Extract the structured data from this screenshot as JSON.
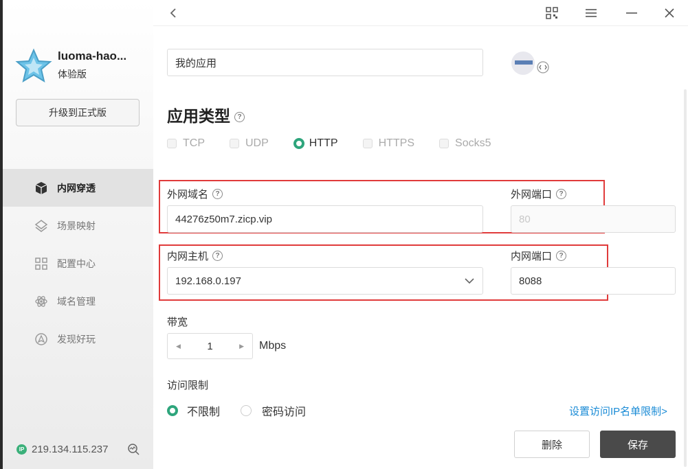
{
  "sidebar": {
    "app_name": "luoma-hao...",
    "edition": "体验版",
    "upgrade_label": "升级到正式版",
    "items": [
      {
        "label": "内网穿透",
        "icon": "cube-icon",
        "active": true
      },
      {
        "label": "场景映射",
        "icon": "layers-icon",
        "active": false
      },
      {
        "label": "配置中心",
        "icon": "grid-icon",
        "active": false
      },
      {
        "label": "域名管理",
        "icon": "atom-icon",
        "active": false
      },
      {
        "label": "发现好玩",
        "icon": "compass-icon",
        "active": false
      }
    ],
    "ip_badge": "IP",
    "ip_address": "219.134.115.237"
  },
  "topbar": {
    "back_icon": "chevron-left-icon",
    "qr_icon": "qrcode-icon",
    "menu_icon": "hamburger-icon",
    "minimize_icon": "minimize-icon",
    "close_icon": "close-icon"
  },
  "form": {
    "app_name_value": "我的应用",
    "app_type_title": "应用类型",
    "help_mark": "?",
    "types": [
      "TCP",
      "UDP",
      "HTTP",
      "HTTPS",
      "Socks5"
    ],
    "selected_type": "HTTP",
    "ext_domain_label": "外网域名",
    "ext_domain_value": "44276z50m7.zicp.vip",
    "ext_port_label": "外网端口",
    "ext_port_value": "80",
    "int_host_label": "内网主机",
    "int_host_value": "192.168.0.197",
    "int_port_label": "内网端口",
    "int_port_value": "8088",
    "bandwidth_label": "带宽",
    "bandwidth_value": "1",
    "bandwidth_unit": "Mbps",
    "access_label": "访问限制",
    "access_options": [
      "不限制",
      "密码访问"
    ],
    "access_selected": "不限制",
    "ip_limit_link": "设置访问IP名单限制>",
    "delete_label": "删除",
    "save_label": "保存"
  },
  "colors": {
    "accent_green": "#2ea57c",
    "highlight_red": "#e03a3a",
    "link_blue": "#1a8bd6",
    "save_button": "#4a4a4a"
  }
}
